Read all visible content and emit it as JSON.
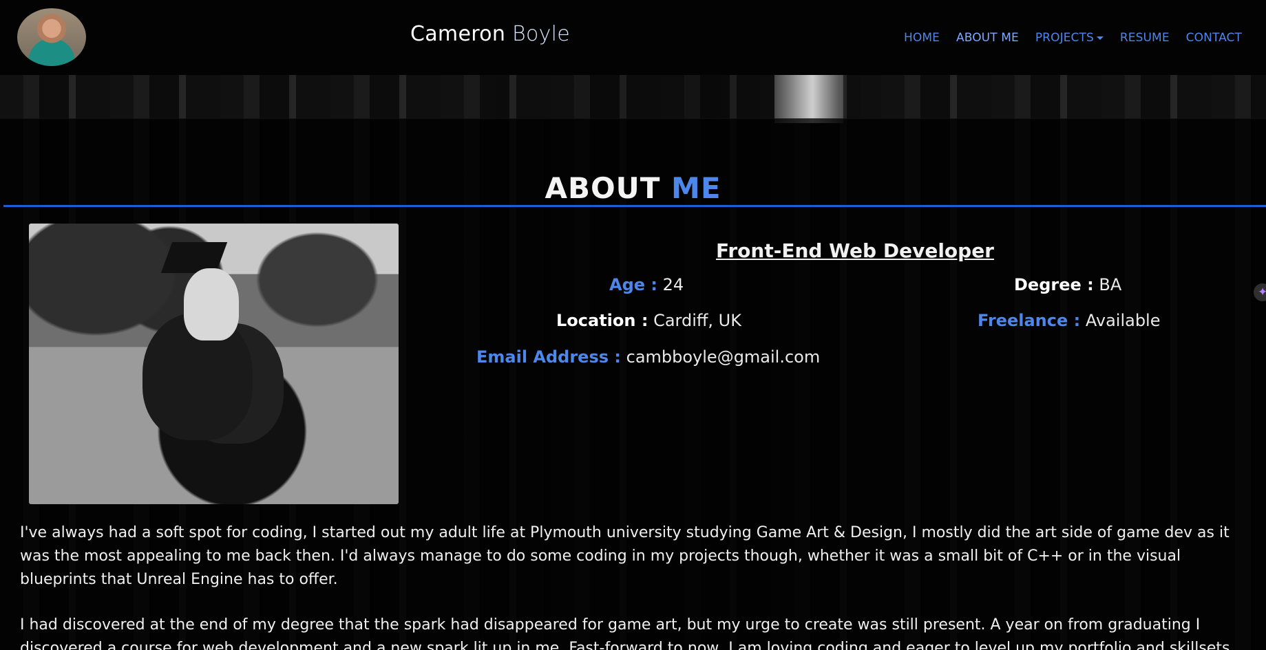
{
  "header": {
    "first_name": "Cameron",
    "last_name": "Boyle",
    "nav": {
      "home": "HOME",
      "about": "ABOUT ME",
      "projects": "PROJECTS",
      "resume": "RESUME",
      "contact": "CONTACT"
    },
    "accent_color": "#4f86ea"
  },
  "about": {
    "title_prefix": "ABOUT",
    "title_accent": "ME",
    "role": "Front-End Web Developer",
    "details": {
      "age_label": "Age :",
      "age": "24",
      "degree_label": "Degree :",
      "degree": "BA",
      "location_label": "Location :",
      "location": "Cardiff, UK",
      "freelance_label": "Freelance :",
      "freelance": "Available",
      "email_label": "Email Address :",
      "email": "cambboyle@gmail.com"
    },
    "bio": [
      "I've always had a soft spot for coding, I started out my adult life at Plymouth university studying Game Art & Design, I mostly did the art side of game dev as it was the most appealing to me back then. I'd always manage to do some coding in my projects though, whether it was a small bit of C++ or in the visual blueprints that Unreal Engine has to offer.",
      "I had discovered at the end of my degree that the spark had disappeared for game art, but my urge to create was still present. A year on from graduating I discovered a course for web development and a new spark lit up in me. Fast-forward to now, I am loving coding and eager to level up my portfolio and skillsets."
    ]
  },
  "icons": {
    "sparkle": "✦"
  }
}
